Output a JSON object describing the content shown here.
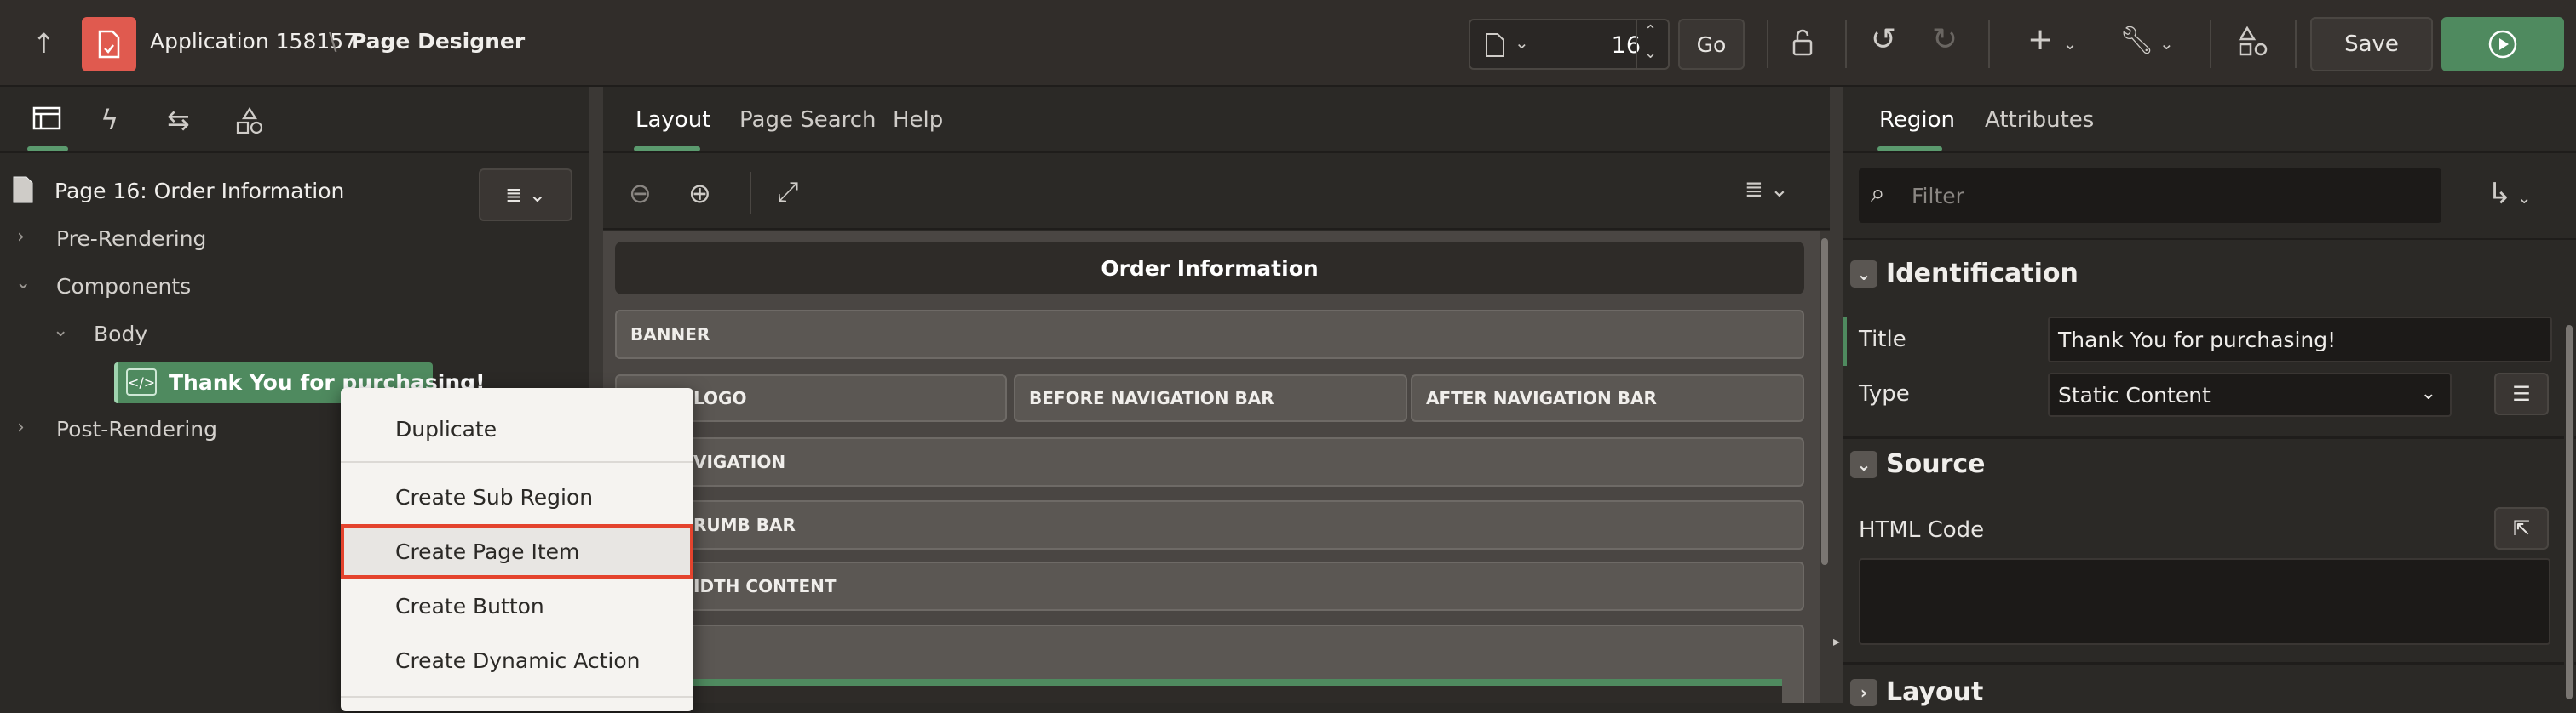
{
  "header": {
    "app_name": "Application 158157",
    "separator": "\\",
    "page_designer": "Page Designer",
    "page_number": "16",
    "go_label": "Go",
    "save_label": "Save",
    "accent_color": "#4f8a5f",
    "logo_color": "#e05a4f"
  },
  "left_panel": {
    "page_title": "Page 16: Order Information",
    "tree": {
      "pre_rendering": "Pre-Rendering",
      "components": "Components",
      "body": "Body",
      "region": "Thank You for purchasing!",
      "post_rendering": "Post-Rendering"
    }
  },
  "context_menu": {
    "items": [
      "Duplicate",
      "Create Sub Region",
      "Create Page Item",
      "Create Button",
      "Create Dynamic Action"
    ],
    "selected": "Create Page Item"
  },
  "center_panel": {
    "tabs": [
      "Layout",
      "Page Search",
      "Help"
    ],
    "active_tab": "Layout",
    "layout_title": "Order Information",
    "zones": {
      "banner": "BANNER",
      "logo": "LOGO",
      "before_nav": "BEFORE NAVIGATION BAR",
      "after_nav": "AFTER NAVIGATION BAR",
      "navigation": "VIGATION",
      "breadcrumb": "RUMB BAR",
      "full_width": "IDTH CONTENT"
    }
  },
  "right_panel": {
    "tabs": [
      "Region",
      "Attributes"
    ],
    "active_tab": "Region",
    "filter_placeholder": "Filter",
    "sections": {
      "identification": "Identification",
      "source": "Source",
      "layout": "Layout"
    },
    "fields": {
      "title_label": "Title",
      "title_value": "Thank You for purchasing!",
      "type_label": "Type",
      "type_value": "Static Content",
      "html_code_label": "HTML Code"
    }
  }
}
